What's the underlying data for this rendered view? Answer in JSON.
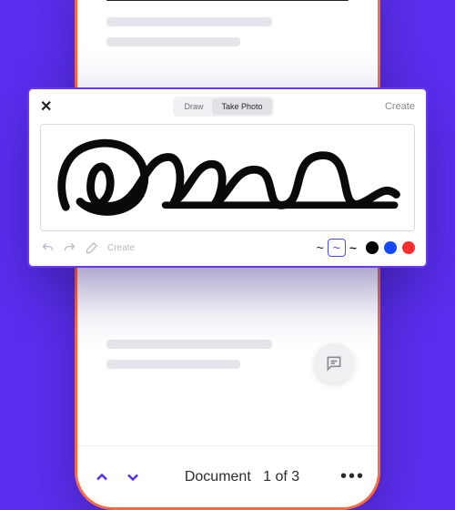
{
  "signature_panel": {
    "tabs": {
      "draw": "Draw",
      "take_photo": "Take Photo"
    },
    "active_tab": "take_photo",
    "create_label": "Create",
    "bottom_create_label": "Create",
    "stroke_options": [
      "thin",
      "medium",
      "thick"
    ],
    "selected_stroke": "medium",
    "colors": {
      "black": "#000000",
      "blue": "#1449ff",
      "red": "#ff2d2d"
    }
  },
  "phone": {
    "footer": {
      "doc_label": "Document",
      "pager": "1 of 3"
    }
  }
}
